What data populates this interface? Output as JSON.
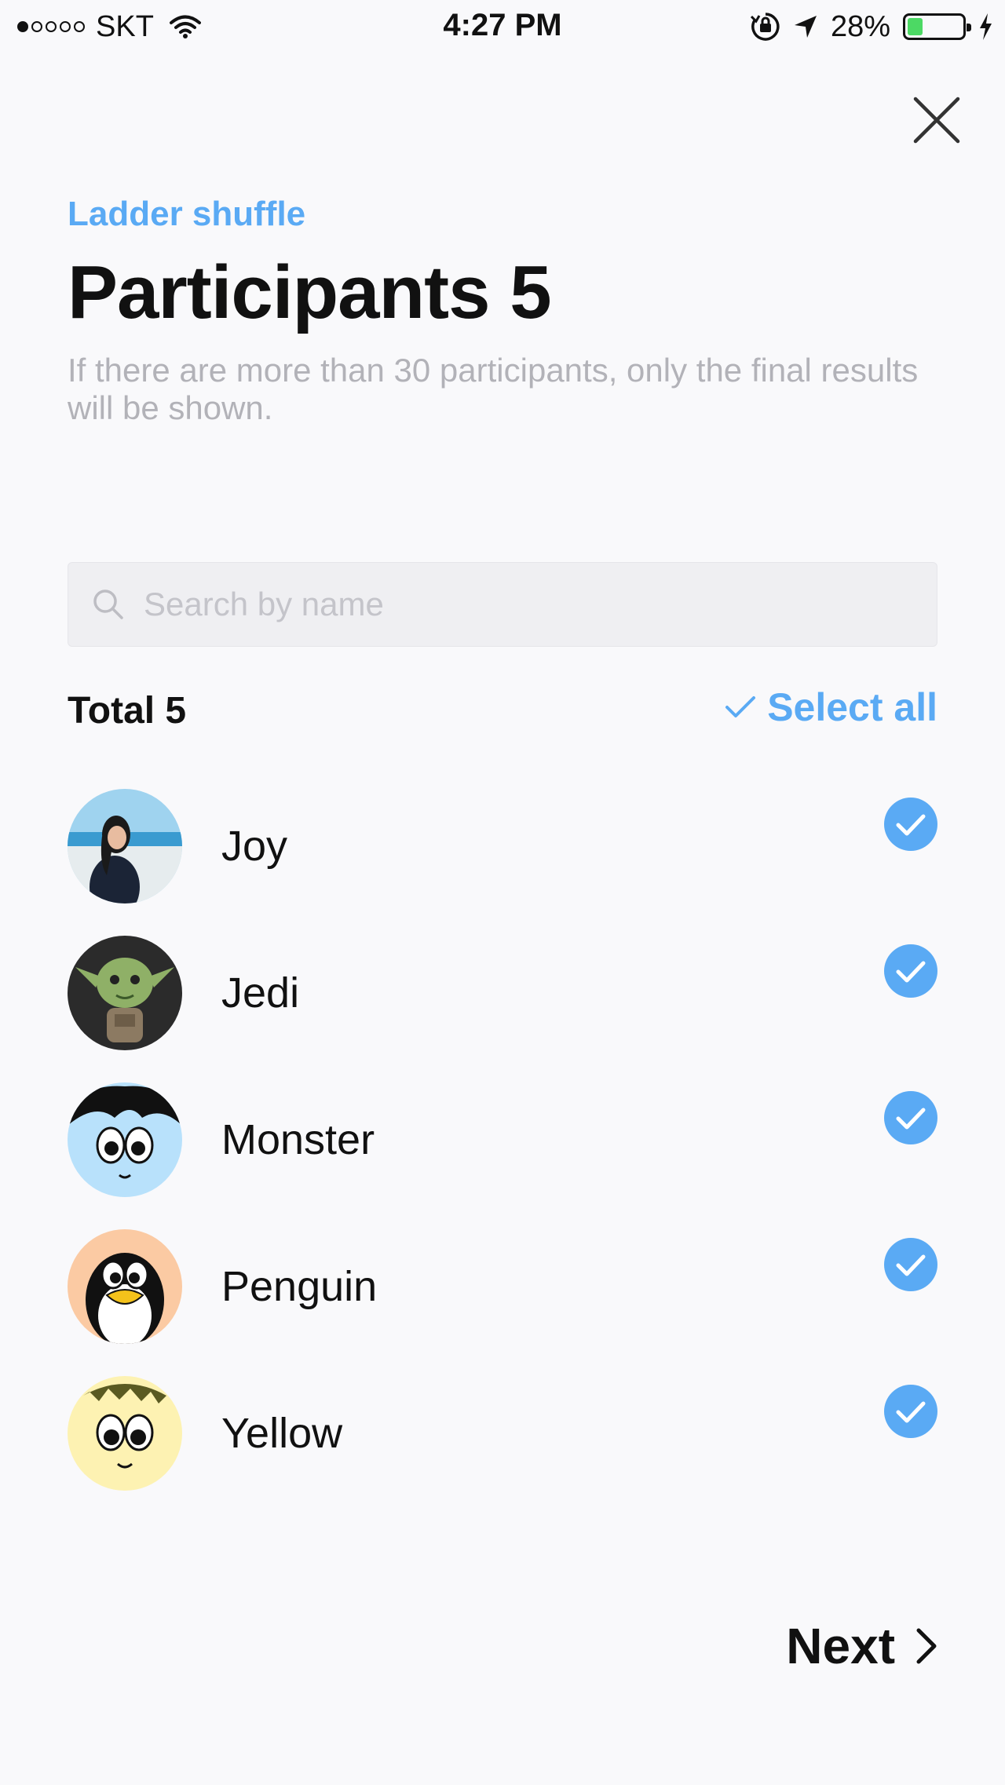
{
  "status_bar": {
    "carrier": "SKT",
    "time": "4:27 PM",
    "battery": "28%",
    "battery_level": 0.28,
    "signal_bars": 1,
    "icons": [
      "wifi-icon",
      "orientation-lock-icon",
      "location-arrow-icon",
      "battery-icon",
      "charging-bolt-icon"
    ]
  },
  "header": {
    "eyebrow": "Ladder shuffle",
    "title": "Participants 5",
    "subtitle": "If there are more than 30 participants, only the final results will be shown."
  },
  "search": {
    "placeholder": "Search by name",
    "value": ""
  },
  "list_header": {
    "total": "Total 5",
    "select_all": "Select all"
  },
  "participants": [
    {
      "name": "Joy",
      "selected": true
    },
    {
      "name": "Jedi",
      "selected": true
    },
    {
      "name": "Monster",
      "selected": true
    },
    {
      "name": "Penguin",
      "selected": true
    },
    {
      "name": "Yellow",
      "selected": true
    }
  ],
  "footer": {
    "next": "Next"
  },
  "colors": {
    "accent": "#5aaaf4",
    "background": "#f9f9fb",
    "muted_text": "#b2b2b8",
    "battery_fill": "#4cd964"
  }
}
